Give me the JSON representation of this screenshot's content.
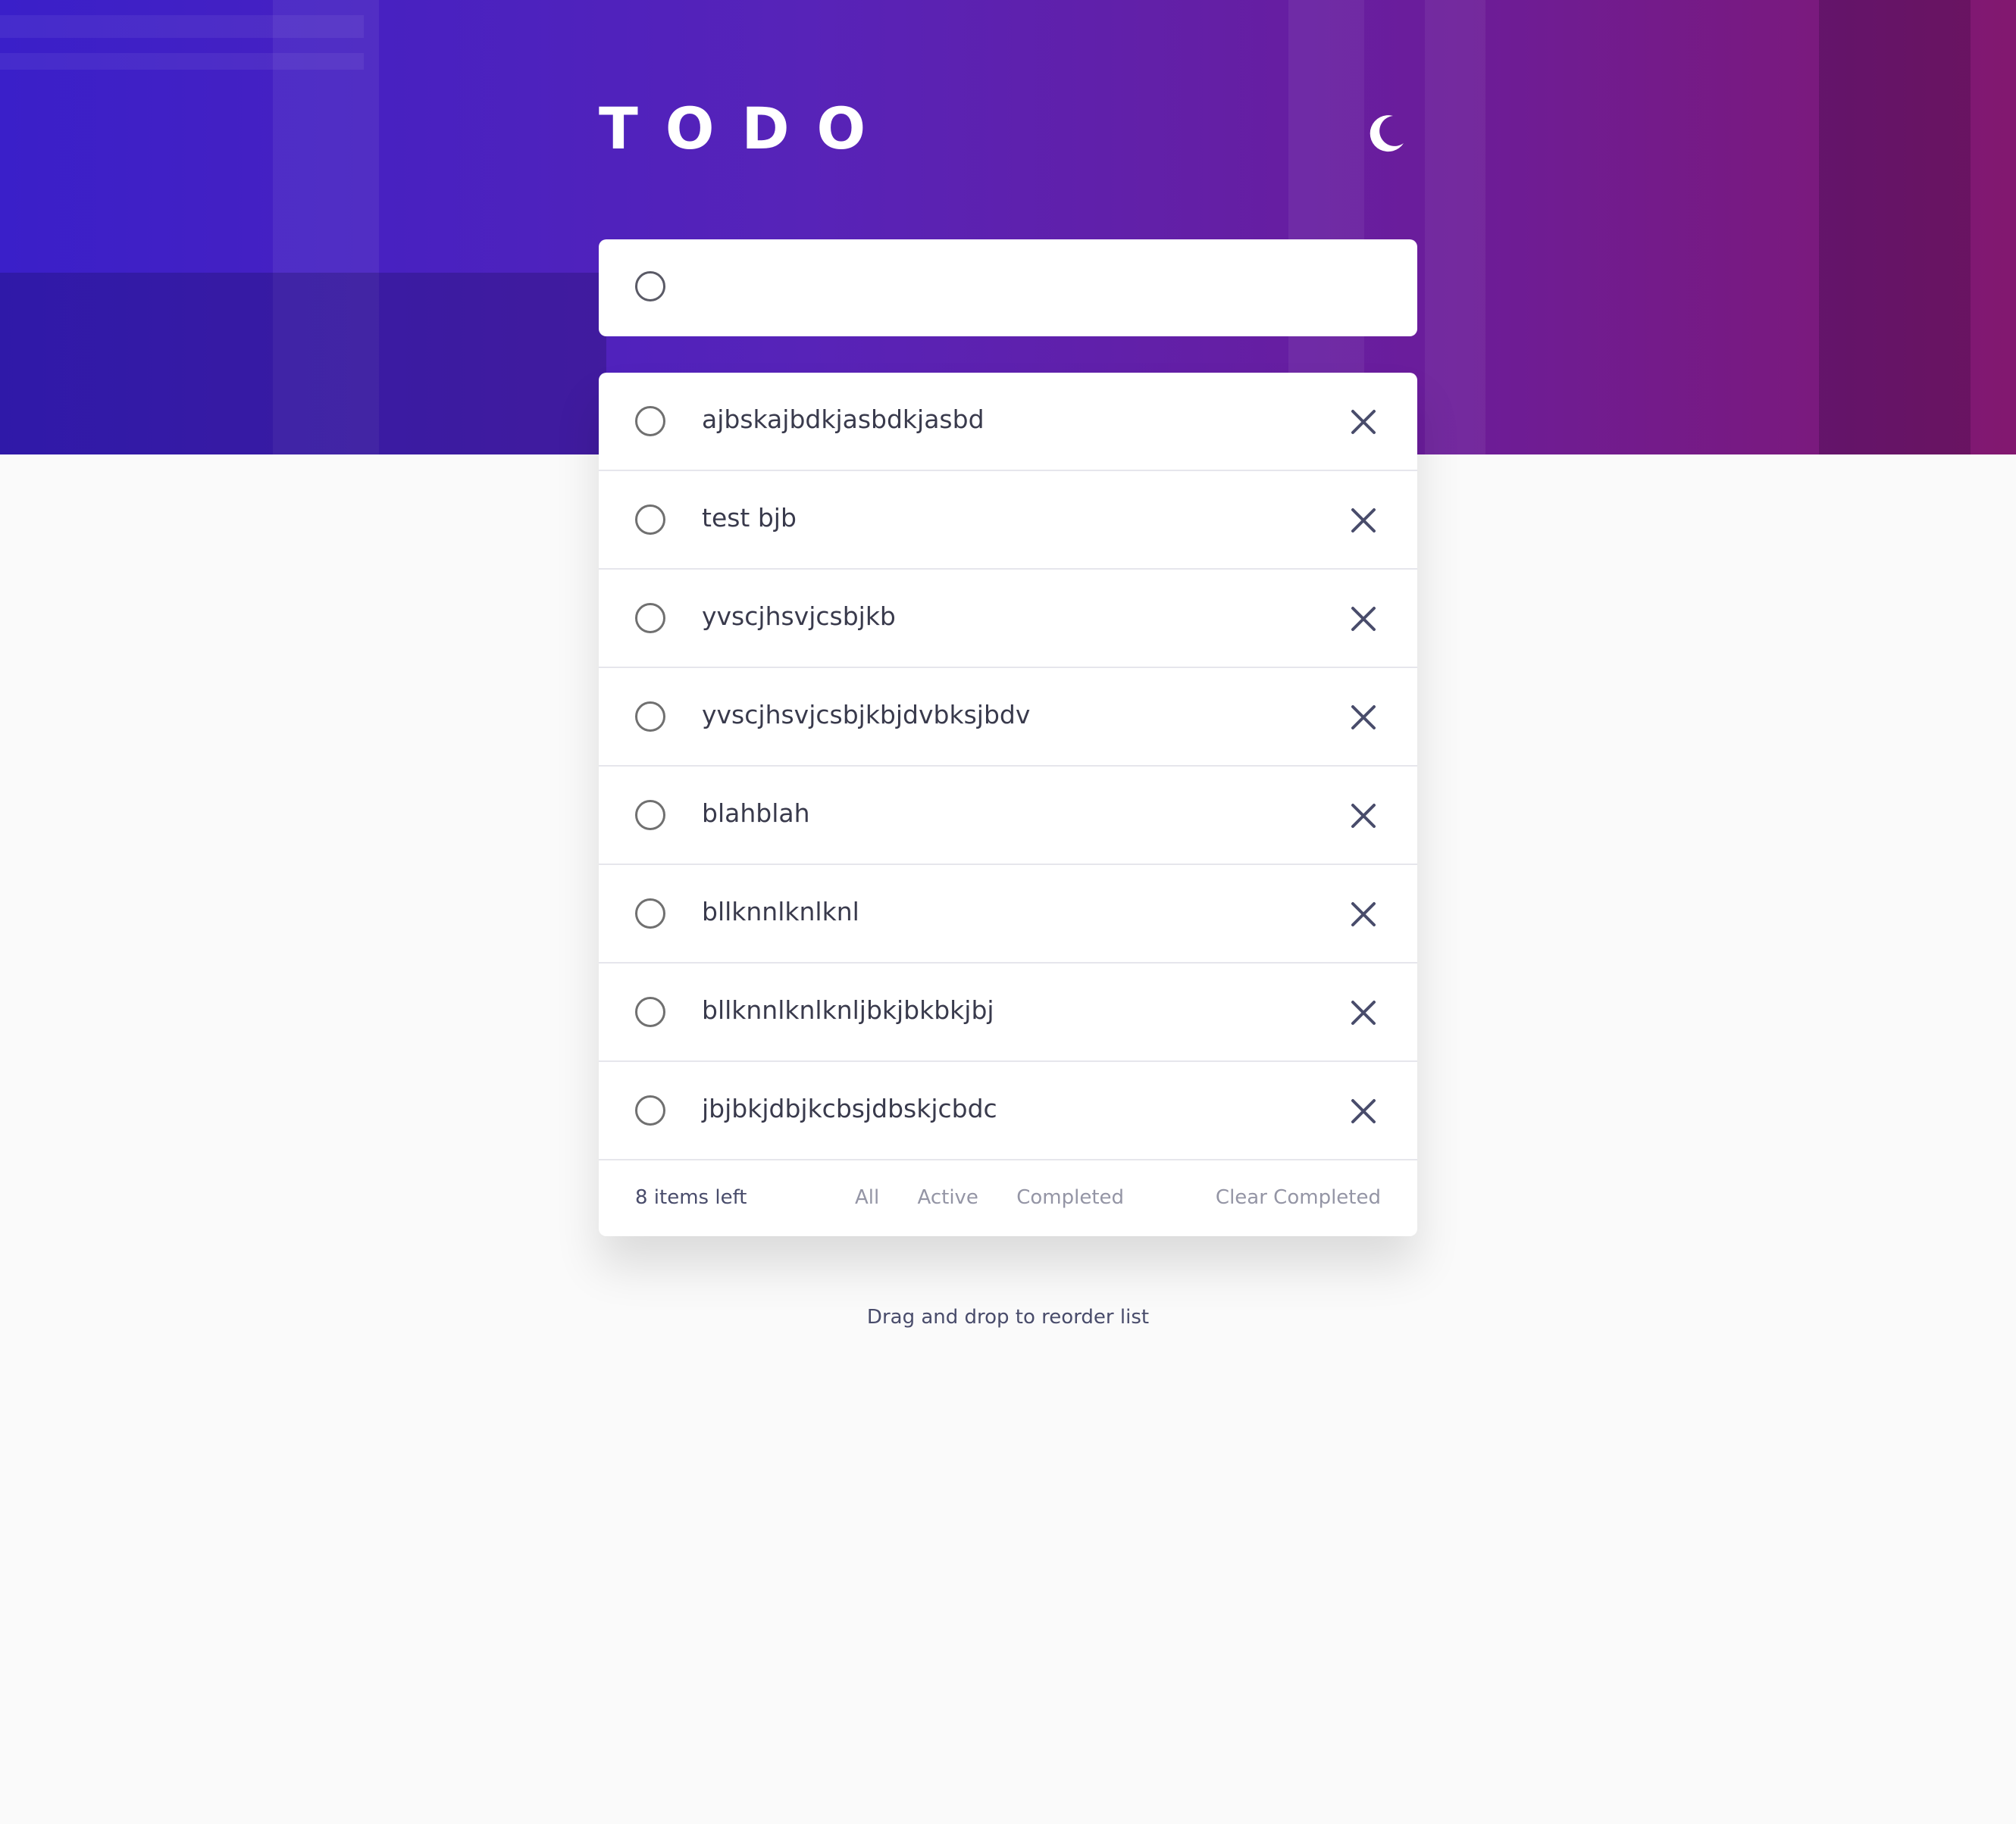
{
  "header": {
    "title": "TODO",
    "theme_toggle_icon": "moon-icon"
  },
  "new_todo": {
    "value": "",
    "placeholder": ""
  },
  "todos": [
    {
      "text": "ajbskajbdkjasbdkjasbd",
      "completed": false
    },
    {
      "text": "test bjb",
      "completed": false
    },
    {
      "text": "yvscjhsvjcsbjkb",
      "completed": false
    },
    {
      "text": "yvscjhsvjcsbjkbjdvbksjbdv",
      "completed": false
    },
    {
      "text": "blahblah",
      "completed": false
    },
    {
      "text": "bllknnlknlknl",
      "completed": false
    },
    {
      "text": "bllknnlknlknljbkjbkbkjbj",
      "completed": false
    },
    {
      "text": "jbjbkjdbjkcbsjdbskjcbdc",
      "completed": false
    }
  ],
  "footer": {
    "items_left": "8 items left",
    "filters": [
      "All",
      "Active",
      "Completed"
    ],
    "clear_label": "Clear Completed"
  },
  "hint": "Drag and drop to reorder list",
  "colors": {
    "gradient_start": "#3a1fc9",
    "gradient_end": "#82186f",
    "text_primary": "#393a4c",
    "text_muted": "#9495a5",
    "background": "#fafafa"
  }
}
